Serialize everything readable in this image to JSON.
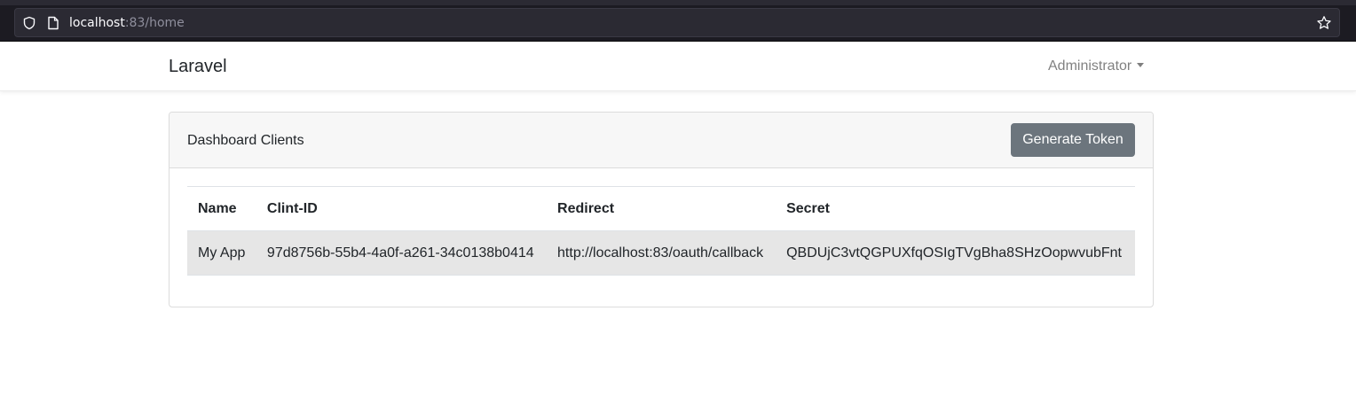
{
  "browser": {
    "url_host": "localhost",
    "url_rest": ":83/home"
  },
  "navbar": {
    "brand": "Laravel",
    "user_menu_label": "Administrator"
  },
  "card": {
    "title": "Dashboard Clients",
    "generate_button_label": "Generate Token"
  },
  "table": {
    "columns": [
      "Name",
      "Clint-ID",
      "Redirect",
      "Secret"
    ],
    "rows": [
      [
        "My App",
        "97d8756b-55b4-4a0f-a261-34c0138b0414",
        "http://localhost:83/oauth/callback",
        "QBDUjC3vtQGPUXfqOSIgTVgBha8SHzOopwvubFnt"
      ]
    ]
  },
  "colors": {
    "button_bg": "#6c757d",
    "row_highlight": "#e6e6e6",
    "browser_bg": "#1c1b22"
  },
  "icons": [
    "shield-icon",
    "page-icon",
    "bookmark-star-icon",
    "chevron-down-icon"
  ]
}
